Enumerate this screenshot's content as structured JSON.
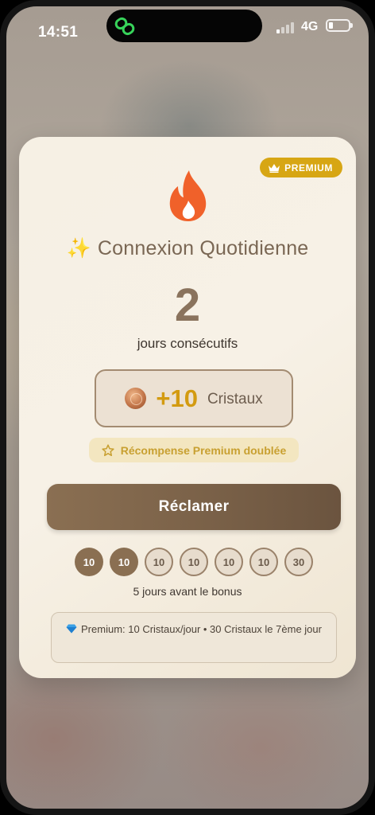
{
  "status_bar": {
    "time": "14:51",
    "network": "4G"
  },
  "card": {
    "premium_badge": "PREMIUM",
    "title": "Connexion Quotidienne",
    "streak_count": "2",
    "streak_label": "jours consécutifs",
    "reward": {
      "amount": "+10",
      "unit": "Cristaux"
    },
    "premium_bonus": "Récompense Premium doublée",
    "claim_label": "Réclamer",
    "days": [
      {
        "value": "10",
        "claimed": true
      },
      {
        "value": "10",
        "claimed": true
      },
      {
        "value": "10",
        "claimed": false
      },
      {
        "value": "10",
        "claimed": false
      },
      {
        "value": "10",
        "claimed": false
      },
      {
        "value": "10",
        "claimed": false
      },
      {
        "value": "30",
        "claimed": false
      }
    ],
    "days_left": "5 jours avant le bonus",
    "info": "Premium: 10 Cristaux/jour • 30 Cristaux le 7ème jour"
  },
  "colors": {
    "accent_brown": "#8a6f52",
    "gold": "#d39b11",
    "flame": "#f0612a"
  },
  "icons": [
    "link-icon",
    "crown-icon",
    "flame-icon",
    "sparkle-icon",
    "coin-icon",
    "star-icon",
    "gem-icon"
  ]
}
